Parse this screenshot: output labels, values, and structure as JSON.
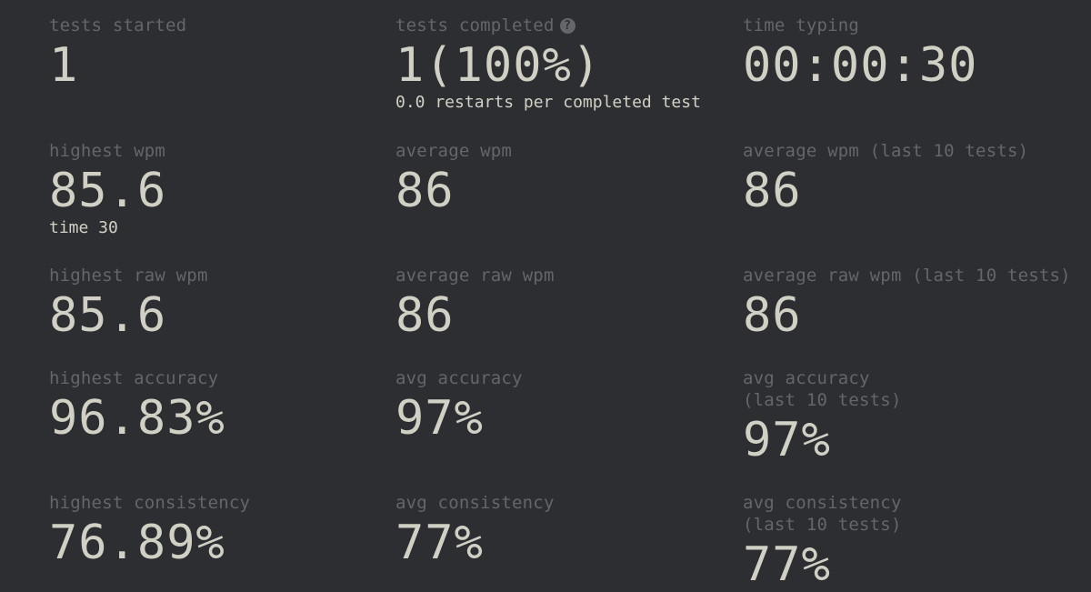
{
  "stats": {
    "tests_started": {
      "label": "tests started",
      "value": "1"
    },
    "tests_completed": {
      "label": "tests completed",
      "value": "1(100%)",
      "sub": "0.0 restarts per completed test",
      "help_icon": "question-circle-icon",
      "help_glyph": "?"
    },
    "time_typing": {
      "label": "time typing",
      "value": "00:00:30"
    },
    "highest_wpm": {
      "label": "highest wpm",
      "value": "85.6",
      "sub": "time 30"
    },
    "average_wpm": {
      "label": "average wpm",
      "value": "86"
    },
    "average_wpm_last10": {
      "label": "average wpm (last 10 tests)",
      "value": "86"
    },
    "highest_raw_wpm": {
      "label": "highest raw wpm",
      "value": "85.6"
    },
    "average_raw_wpm": {
      "label": "average raw wpm",
      "value": "86"
    },
    "average_raw_wpm_last10": {
      "label": "average raw wpm (last 10 tests)",
      "value": "86"
    },
    "highest_accuracy": {
      "label": "highest accuracy",
      "value": "96.83%"
    },
    "avg_accuracy": {
      "label": "avg accuracy",
      "value": "97%"
    },
    "avg_accuracy_last10": {
      "label_line1": "avg accuracy",
      "label_line2": "(last 10 tests)",
      "value": "97%"
    },
    "highest_consistency": {
      "label": "highest consistency",
      "value": "76.89%"
    },
    "avg_consistency": {
      "label": "avg consistency",
      "value": "77%"
    },
    "avg_consistency_last10": {
      "label_line1": "avg consistency",
      "label_line2": "(last 10 tests)",
      "value": "77%"
    }
  },
  "colors": {
    "background": "#2c2e31",
    "label": "#646669",
    "value": "#d1d0c5"
  }
}
